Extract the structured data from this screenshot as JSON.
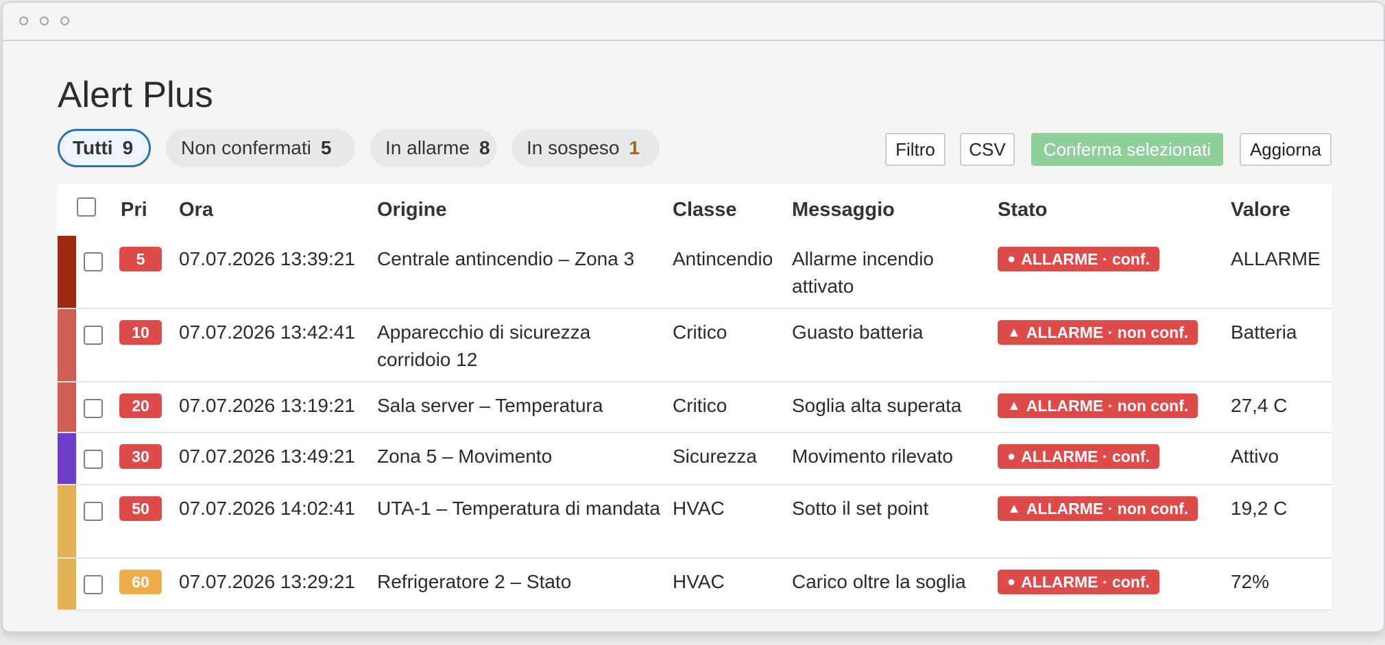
{
  "app": {
    "title": "Alert Plus"
  },
  "tabs": [
    {
      "label": "Tutti",
      "count": "9"
    },
    {
      "label": "Non confermati",
      "count": "5"
    },
    {
      "label": "In allarme",
      "count": "8"
    },
    {
      "label": "In sospeso",
      "count": "1"
    }
  ],
  "toolbar": {
    "filter_label": "Filtro",
    "csv_label": "CSV",
    "confirm_label": "Conferma selezionati",
    "refresh_label": "Aggiorna"
  },
  "table": {
    "headers": [
      "Pri",
      "Ora",
      "Origine",
      "Classe",
      "Messaggio",
      "Stato",
      "Valore"
    ],
    "rows": [
      {
        "pri": "5",
        "ora": "07.07.2026 13:39:21",
        "origine": "Centrale antincendio – Zona 3",
        "classe": "Antincendio",
        "messaggio": "Allarme incendio attivato",
        "stato": "ALLARME · conf.",
        "stato_icon": "●",
        "valore": "ALLARME",
        "stripe": "#9b2a10",
        "pri_color": "red"
      },
      {
        "pri": "10",
        "ora": "07.07.2026 13:42:41",
        "origine": "Apparecchio di sicurezza corridoio 12",
        "classe": "Critico",
        "messaggio": "Guasto batteria",
        "stato": "ALLARME · non conf.",
        "stato_icon": "▲",
        "valore": "Batteria",
        "stripe": "#cf5f52",
        "pri_color": "red"
      },
      {
        "pri": "20",
        "ora": "07.07.2026 13:19:21",
        "origine": "Sala server – Temperatura",
        "classe": "Critico",
        "messaggio": "Soglia alta superata",
        "stato": "ALLARME · non conf.",
        "stato_icon": "▲",
        "valore": "27,4 C",
        "stripe": "#cf5f52",
        "pri_color": "red"
      },
      {
        "pri": "30",
        "ora": "07.07.2026 13:49:21",
        "origine": "Zona 5 – Movimento",
        "classe": "Sicurezza",
        "messaggio": "Movimento rilevato",
        "stato": "ALLARME · conf.",
        "stato_icon": "●",
        "valore": "Attivo",
        "stripe": "#6c3fc6",
        "pri_color": "red"
      },
      {
        "pri": "50",
        "ora": "07.07.2026 14:02:41",
        "origine": "UTA-1 – Temperatura di mandata",
        "classe": "HVAC",
        "messaggio": "Sotto il set point",
        "stato": "ALLARME · non conf.",
        "stato_icon": "▲",
        "valore": "19,2 C",
        "stripe": "#e3b257",
        "pri_color": "red"
      },
      {
        "pri": "60",
        "ora": "07.07.2026 13:29:21",
        "origine": "Refrigeratore 2 – Stato",
        "classe": "HVAC",
        "messaggio": "Carico oltre la soglia",
        "stato": "ALLARME · conf.",
        "stato_icon": "●",
        "valore": "72%",
        "stripe": "#e3b257",
        "pri_color": "amber"
      }
    ]
  }
}
